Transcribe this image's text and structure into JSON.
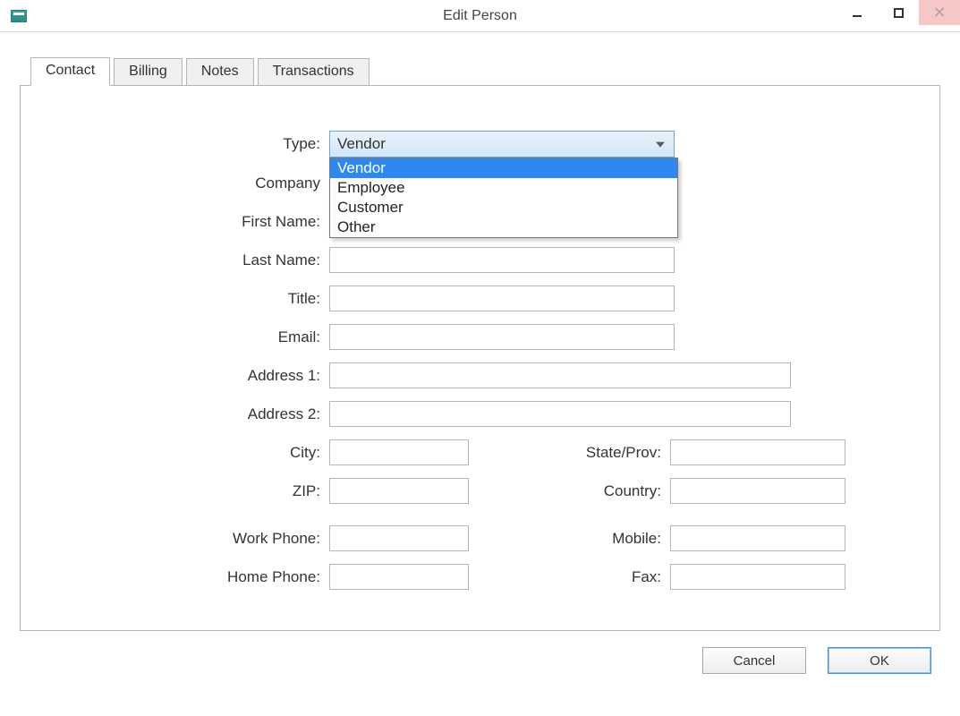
{
  "window": {
    "title": "Edit Person",
    "minimize_label": "Minimize",
    "maximize_label": "Maximize",
    "close_label": "Close"
  },
  "tabs": {
    "contact": "Contact",
    "billing": "Billing",
    "notes": "Notes",
    "transactions": "Transactions"
  },
  "form": {
    "type_label": "Type:",
    "type_value": "Vendor",
    "type_options": {
      "0": "Vendor",
      "1": "Employee",
      "2": "Customer",
      "3": "Other"
    },
    "company_label": "Company",
    "company_value": "",
    "first_name_label": "First Name:",
    "first_name_value": "",
    "last_name_label": "Last Name:",
    "last_name_value": "",
    "title_label": "Title:",
    "title_value": "",
    "email_label": "Email:",
    "email_value": "",
    "address1_label": "Address 1:",
    "address1_value": "",
    "address2_label": "Address 2:",
    "address2_value": "",
    "city_label": "City:",
    "city_value": "",
    "state_label": "State/Prov:",
    "state_value": "",
    "zip_label": "ZIP:",
    "zip_value": "",
    "country_label": "Country:",
    "country_value": "",
    "work_phone_label": "Work Phone:",
    "work_phone_value": "",
    "mobile_label": "Mobile:",
    "mobile_value": "",
    "home_phone_label": "Home Phone:",
    "home_phone_value": "",
    "fax_label": "Fax:",
    "fax_value": ""
  },
  "buttons": {
    "cancel": "Cancel",
    "ok": "OK"
  }
}
